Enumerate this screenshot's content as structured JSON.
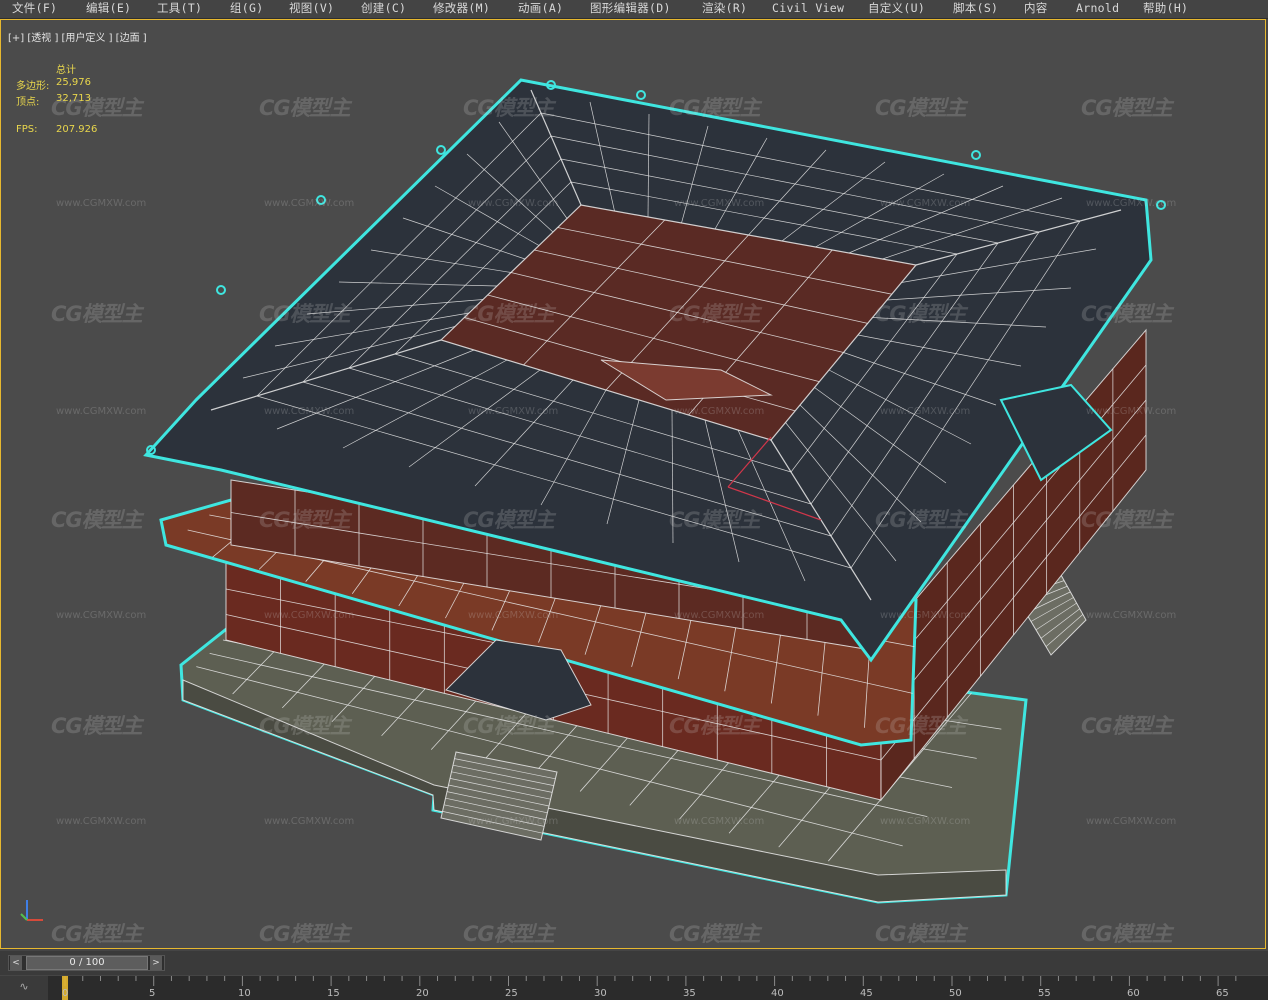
{
  "menu": [
    {
      "label": "文件(F)"
    },
    {
      "label": "编辑(E)"
    },
    {
      "label": "工具(T)"
    },
    {
      "label": "组(G)"
    },
    {
      "label": "视图(V)"
    },
    {
      "label": "创建(C)"
    },
    {
      "label": "修改器(M)"
    },
    {
      "label": "动画(A)"
    },
    {
      "label": "图形编辑器(D)"
    },
    {
      "label": "渲染(R)"
    },
    {
      "label": "Civil View"
    },
    {
      "label": "自定义(U)"
    },
    {
      "label": "脚本(S)"
    },
    {
      "label": "内容"
    },
    {
      "label": "Arnold"
    },
    {
      "label": "帮助(H)"
    }
  ],
  "viewport": {
    "label": "[+] [透视 ] [用户定义 ] [边面 ]",
    "stats": {
      "header": "总计",
      "polys_label": "多边形:",
      "polys_value": "25,976",
      "verts_label": "顶点:",
      "verts_value": "32,713",
      "fps_label": "FPS:",
      "fps_value": "207.926"
    },
    "watermark_logo": "CG模型主",
    "watermark_url": "www.CGMXW.com",
    "colors": {
      "selection": "#3fe6e0",
      "roof": "#2c323b",
      "wall": "#6a2a20",
      "base": "#5d5f52",
      "active_border": "#e7b82f"
    }
  },
  "time_slider": {
    "label": "0 / 100",
    "prev": "<",
    "next": ">",
    "value_fraction": 0.0
  },
  "timeline": {
    "ticks": [
      "0",
      "5",
      "10",
      "15",
      "20",
      "25",
      "30",
      "35",
      "40",
      "45",
      "50",
      "55",
      "60",
      "65"
    ]
  },
  "icons": {
    "axis": "axis-gizmo-icon",
    "mini": "mini-curve-icon"
  }
}
